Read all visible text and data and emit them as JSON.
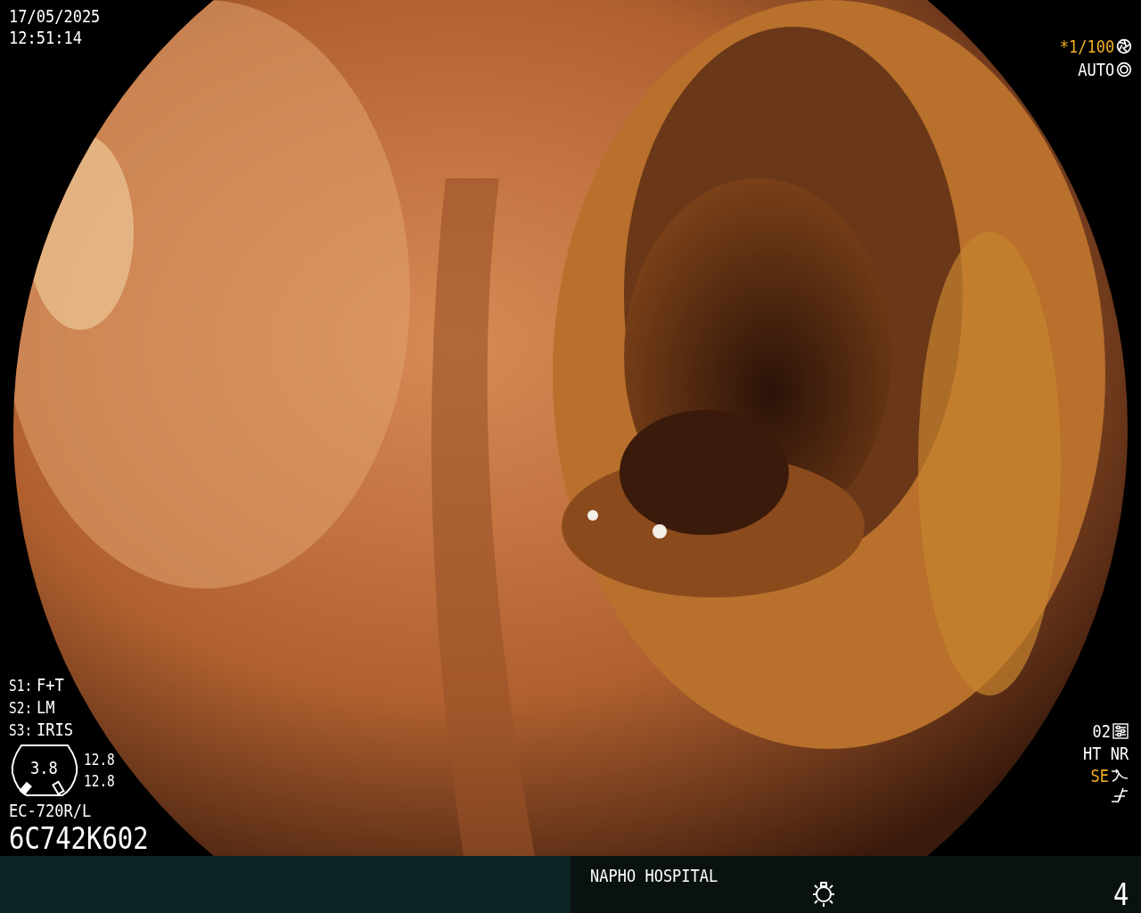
{
  "timestamp": {
    "date": "17/05/2025",
    "time": "12:51:14"
  },
  "shutter": {
    "speed": "*1/100",
    "mode": "AUTO"
  },
  "scope_switches": [
    {
      "label": "S1:",
      "value": "F+T"
    },
    {
      "label": "S2:",
      "value": "LM"
    },
    {
      "label": "S3:",
      "value": "IRIS"
    }
  ],
  "gauge": {
    "value": "3.8",
    "readings": [
      "12.8",
      "12.8"
    ]
  },
  "scope": {
    "model": "EC-720R/L",
    "serial": "6C742K602"
  },
  "settings": {
    "preset": "02",
    "modes": "HT NR",
    "enhance": "SE"
  },
  "footer": {
    "hospital": "NAPHO HOSPITAL",
    "page": "4"
  }
}
